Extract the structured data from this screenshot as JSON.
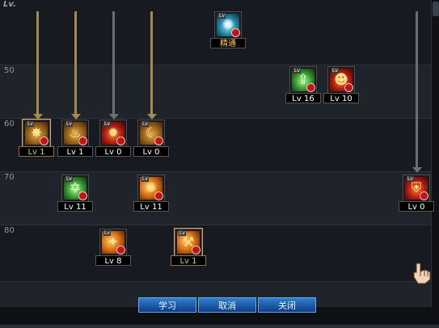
{
  "header": {
    "lv_label": "Lv."
  },
  "level_rows": [
    {
      "label": ""
    },
    {
      "label": "50"
    },
    {
      "label": "60"
    },
    {
      "label": "70"
    },
    {
      "label": "80"
    }
  ],
  "skills": [
    {
      "name": "skill-master",
      "caption": "精通",
      "color": "teal",
      "glyph": "✺",
      "tag": "Lv",
      "state": "master"
    },
    {
      "name": "skill-lv50-a",
      "caption": "Lv 16",
      "color": "green",
      "glyph": "⇧",
      "tag": "Lv"
    },
    {
      "name": "skill-lv50-b",
      "caption": "Lv 10",
      "color": "red",
      "glyph": "☻",
      "tag": "Lv"
    },
    {
      "name": "skill-lv60-a",
      "caption": "Lv 1",
      "color": "gold",
      "glyph": "✸",
      "tag": "Lv",
      "state": "selected"
    },
    {
      "name": "skill-lv60-b",
      "caption": "Lv 1",
      "color": "gold",
      "glyph": "♨",
      "tag": "Lv"
    },
    {
      "name": "skill-lv60-c",
      "caption": "Lv 0",
      "color": "red",
      "glyph": "✹",
      "tag": "Lv"
    },
    {
      "name": "skill-lv60-d",
      "caption": "Lv 0",
      "color": "gold",
      "glyph": "☾",
      "tag": "Lv"
    },
    {
      "name": "skill-lv70-a",
      "caption": "Lv 11",
      "color": "green",
      "glyph": "✡",
      "tag": "Lv"
    },
    {
      "name": "skill-lv70-b",
      "caption": "Lv 11",
      "color": "fire",
      "glyph": "✺",
      "tag": "Lv"
    },
    {
      "name": "skill-lv70-c",
      "caption": "Lv 0",
      "color": "red",
      "glyph": "⛨",
      "tag": "Lv"
    },
    {
      "name": "skill-lv80-a",
      "caption": "Lv 8",
      "color": "fire",
      "glyph": "✦",
      "tag": "Lv"
    },
    {
      "name": "skill-lv80-b",
      "caption": "Lv 1",
      "color": "fire",
      "glyph": "⚒",
      "tag": "Lv",
      "state": "selected"
    }
  ],
  "buttons": {
    "learn": "学习",
    "cancel": "取消",
    "close": "关闭"
  },
  "icons": {
    "cursor": "hand-cursor-icon",
    "scroll_thumb": "scrollbar-thumb"
  },
  "colors": {
    "button_fill": "#2f7fd0",
    "arrow_gold": "#a6894d",
    "arrow_grey": "#6b6e73",
    "level_ok": "#8fe36a",
    "master_text": "#ffd34a"
  }
}
